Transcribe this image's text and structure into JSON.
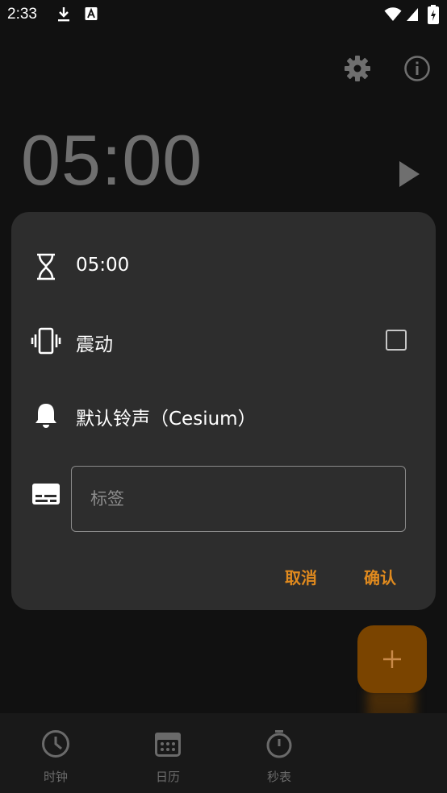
{
  "status_bar": {
    "time": "2:33",
    "icons": [
      "download-icon",
      "font-a-icon",
      "wifi-icon",
      "signal-icon",
      "battery-charging-icon"
    ]
  },
  "toolbar": {
    "settings_icon": "gear-icon",
    "info_icon": "info-icon"
  },
  "timer": {
    "display": "05:00"
  },
  "dialog": {
    "duration": "05:00",
    "vibrate_label": "震动",
    "vibrate_checked": false,
    "ringtone_label": "默认铃声（Cesium）",
    "label_placeholder": "标签",
    "label_value": "",
    "cancel_label": "取消",
    "confirm_label": "确认"
  },
  "fab": {
    "icon": "plus-icon"
  },
  "bottom_nav": {
    "items": [
      {
        "label": "时钟",
        "icon": "clock-icon"
      },
      {
        "label": "日历",
        "icon": "calendar-icon"
      },
      {
        "label": "秒表",
        "icon": "stopwatch-icon"
      }
    ]
  },
  "colors": {
    "accent": "#e08a1e",
    "dialog_bg": "#2d2d2d",
    "screen_bg": "#111111"
  }
}
